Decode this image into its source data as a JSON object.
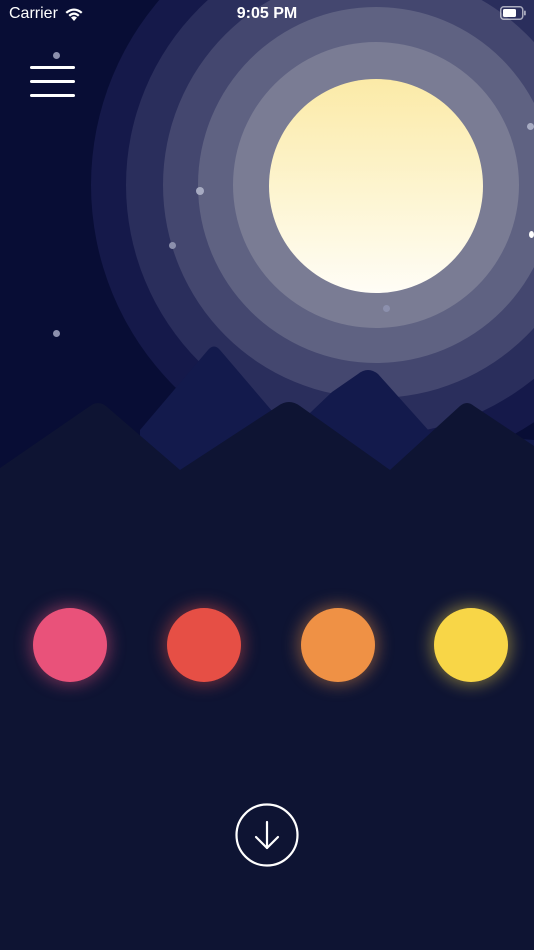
{
  "status_bar": {
    "carrier": "Carrier",
    "time": "9:05 PM",
    "wifi_icon": "wifi-icon",
    "battery_icon": "battery-icon"
  },
  "menu": {
    "icon": "hamburger-menu-icon"
  },
  "scene": {
    "moon_color_top": "#fbeaa7",
    "moon_color_bottom": "#fffdf6",
    "sky_color": "#080d35",
    "ground_color": "#0e1433",
    "mountain_color": "#151b45"
  },
  "color_swatches": [
    {
      "name": "pink",
      "color": "#e9527a"
    },
    {
      "name": "red",
      "color": "#e64f45"
    },
    {
      "name": "orange",
      "color": "#ef9145"
    },
    {
      "name": "yellow",
      "color": "#f8d647"
    }
  ],
  "download": {
    "icon": "arrow-down-circle-icon"
  }
}
